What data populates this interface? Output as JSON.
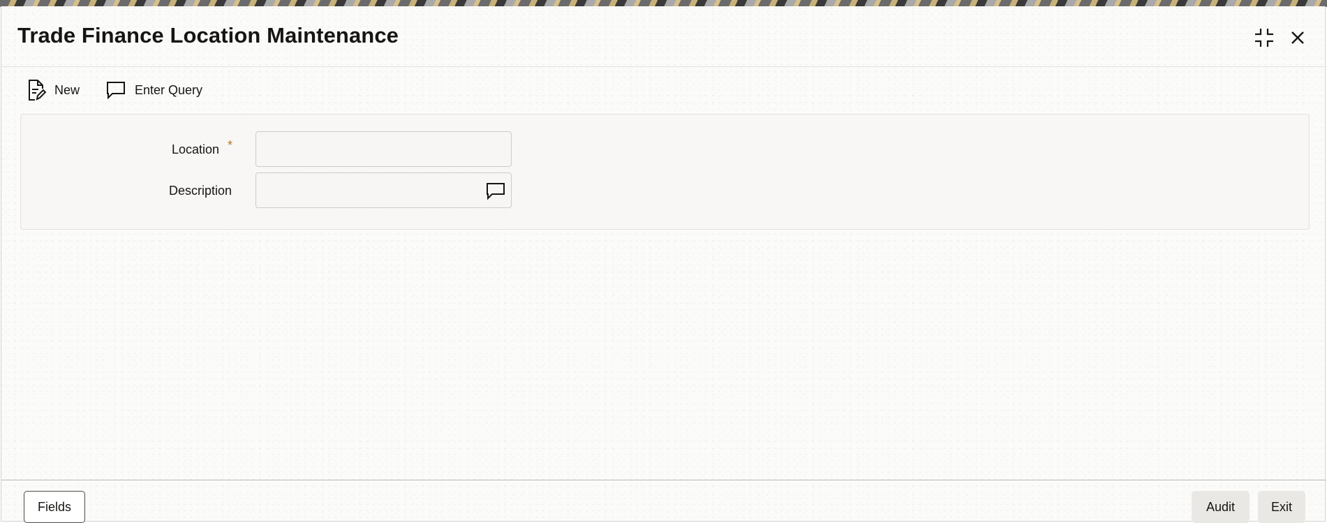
{
  "window": {
    "title": "Trade Finance Location Maintenance",
    "controls": {
      "minimize_icon": "collapse-icon",
      "close_icon": "close-icon"
    }
  },
  "toolbar": {
    "new_label": "New",
    "new_icon": "new-document-icon",
    "enter_query_label": "Enter Query",
    "enter_query_icon": "speech-bubble-icon"
  },
  "form": {
    "location": {
      "label": "Location",
      "required_marker": "*",
      "value": "",
      "placeholder": ""
    },
    "description": {
      "label": "Description",
      "value": "",
      "placeholder": "",
      "icon": "speech-bubble-icon"
    }
  },
  "footer": {
    "fields_label": "Fields",
    "audit_label": "Audit",
    "exit_label": "Exit"
  },
  "colors": {
    "text": "#161513",
    "required": "#b5792d",
    "panel_bg": "#f7f6f4",
    "flat_button_bg": "#e9e8e5"
  }
}
